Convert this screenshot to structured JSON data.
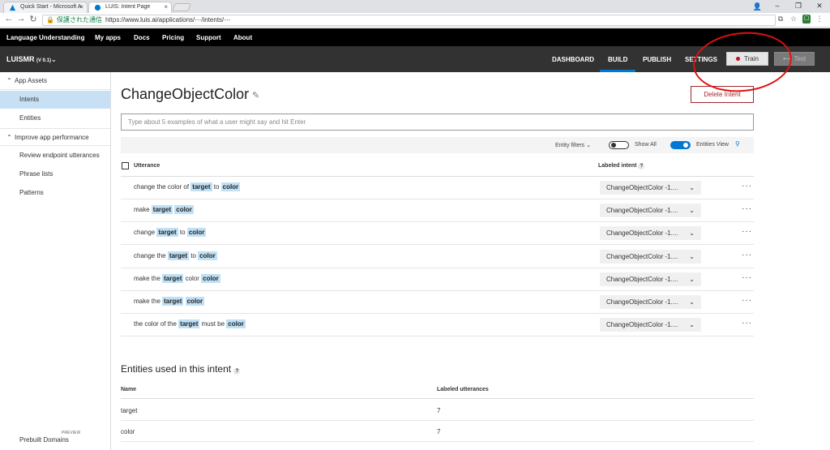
{
  "browser": {
    "tabs": [
      {
        "title": "Quick Start - Microsoft A",
        "active": false
      },
      {
        "title": "LUIS: Intent Page",
        "active": true
      }
    ],
    "secure_label": "保護された通信",
    "url": "https://www.luis.ai/applications/⋯/intents/⋯"
  },
  "topnav": {
    "items": [
      "Language Understanding",
      "My apps",
      "Docs",
      "Pricing",
      "Support",
      "About"
    ]
  },
  "appnav": {
    "app_name": "LUISMR",
    "version": "(V 0.1)",
    "tabs": [
      "DASHBOARD",
      "BUILD",
      "PUBLISH",
      "SETTINGS"
    ],
    "active_tab": "BUILD",
    "train_label": "Train",
    "test_label": "Test",
    "train_dot_color": "#c50f1f",
    "accent_color": "#0078d4"
  },
  "sidebar": {
    "section1": "App Assets",
    "items1": [
      "Intents",
      "Entities"
    ],
    "section2": "Improve app performance",
    "items2": [
      "Review endpoint utterances",
      "Phrase lists",
      "Patterns"
    ],
    "prebuilt": "Prebuilt Domains",
    "preview": "PREVIEW"
  },
  "main": {
    "intent_title": "ChangeObjectColor",
    "delete_label": "Delete Intent",
    "input_placeholder": "Type about 5 examples of what a user might say and hit Enter",
    "filters": {
      "entity_filters": "Entity filters",
      "show_all": "Show All",
      "entities_view": "Entities View"
    },
    "table_headers": {
      "utterance": "Utterance",
      "labeled_intent": "Labeled intent"
    },
    "rows": [
      {
        "parts": [
          "change the color of ",
          "target",
          " to ",
          "color"
        ],
        "intent": "ChangeObjectColor -1...."
      },
      {
        "parts": [
          "make ",
          "target",
          " ",
          "color"
        ],
        "intent": "ChangeObjectColor -1...."
      },
      {
        "parts": [
          "change ",
          "target",
          " to ",
          "color"
        ],
        "intent": "ChangeObjectColor -1...."
      },
      {
        "parts": [
          "change the ",
          "target",
          " to ",
          "color"
        ],
        "intent": "ChangeObjectColor -1...."
      },
      {
        "parts": [
          "make the ",
          "target",
          " color ",
          "color"
        ],
        "intent": "ChangeObjectColor -1...."
      },
      {
        "parts": [
          "make the ",
          "target",
          " ",
          "color"
        ],
        "intent": "ChangeObjectColor -1...."
      },
      {
        "parts": [
          "the color of the ",
          "target",
          " must be ",
          "color"
        ],
        "intent": "ChangeObjectColor -1...."
      }
    ],
    "entities_section_title": "Entities used in this intent",
    "entity_headers": {
      "name": "Name",
      "labeled": "Labeled utterances"
    },
    "entities": [
      {
        "name": "target",
        "count": "7"
      },
      {
        "name": "color",
        "count": "7"
      }
    ]
  }
}
